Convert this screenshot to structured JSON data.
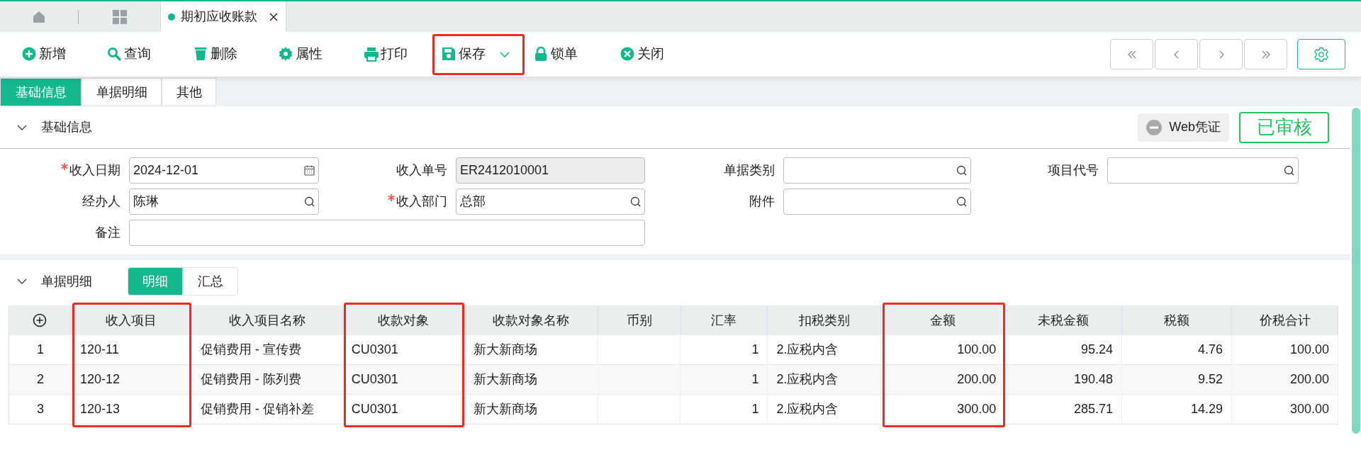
{
  "page_tabs": [
    {
      "title": "期初应收账款",
      "selected": true
    }
  ],
  "toolbar": [
    {
      "label": "新增",
      "dropdown": false,
      "highlighted": false
    },
    {
      "label": "查询",
      "dropdown": false,
      "highlighted": false
    },
    {
      "label": "删除",
      "dropdown": false,
      "highlighted": false
    },
    {
      "label": "属性",
      "dropdown": false,
      "highlighted": false
    },
    {
      "label": "打印",
      "dropdown": false,
      "highlighted": false
    },
    {
      "label": "保存",
      "dropdown": true,
      "highlighted": true
    },
    {
      "label": "锁单",
      "dropdown": false,
      "highlighted": false
    },
    {
      "label": "关闭",
      "dropdown": false,
      "highlighted": false
    }
  ],
  "view_tabs": [
    {
      "label": "基础信息",
      "selected": true
    },
    {
      "label": "单据明细",
      "selected": false
    },
    {
      "label": "其他",
      "selected": false
    }
  ],
  "basic_section": {
    "title": "基础信息",
    "expanded": true,
    "voucher_button": "Web凭证",
    "status_stamp": "已审核",
    "fields": [
      {
        "label": "收入日期",
        "value": "2024-12-01",
        "required": true,
        "kind": "date"
      },
      {
        "label": "收入单号",
        "value": "ER2412010001",
        "required": false,
        "kind": "readonly"
      },
      {
        "label": "单据类别",
        "required": false,
        "kind": "lookup"
      },
      {
        "label": "项目代号",
        "required": false,
        "kind": "lookup"
      },
      {
        "label": "经办人",
        "value": "陈琳",
        "required": false,
        "kind": "lookup"
      },
      {
        "label": "收入部门",
        "value": "总部",
        "required": true,
        "kind": "lookup"
      },
      {
        "label": "附件",
        "required": false,
        "kind": "lookup"
      },
      {
        "label": "备注",
        "required": false,
        "kind": "wide"
      }
    ]
  },
  "detail_section": {
    "title": "单据明细",
    "expanded": true,
    "modes": [
      {
        "label": "明细",
        "selected": true
      },
      {
        "label": "汇总",
        "selected": false
      }
    ]
  },
  "table": {
    "columns": [
      {
        "label": "收入项目",
        "kind": "text",
        "highlighted": true
      },
      {
        "label": "收入项目名称",
        "kind": "text",
        "highlighted": false
      },
      {
        "label": "收款对象",
        "kind": "text",
        "highlighted": true
      },
      {
        "label": "收款对象名称",
        "kind": "text",
        "highlighted": false
      },
      {
        "label": "币别",
        "kind": "text",
        "highlighted": false
      },
      {
        "label": "汇率",
        "kind": "number",
        "highlighted": false
      },
      {
        "label": "扣税类别",
        "kind": "text",
        "highlighted": false
      },
      {
        "label": "金额",
        "kind": "number",
        "highlighted": true
      },
      {
        "label": "未税金额",
        "kind": "number",
        "highlighted": false
      },
      {
        "label": "税额",
        "kind": "number",
        "highlighted": false
      },
      {
        "label": "价税合计",
        "kind": "number",
        "highlighted": false
      }
    ],
    "rows": [
      {
        "index": "1",
        "cells": [
          "120-11",
          "促销费用 - 宣传费",
          "CU0301",
          "新大新商场",
          "",
          "1",
          "2.应税内含",
          "100.00",
          "95.24",
          "4.76",
          "100.00"
        ]
      },
      {
        "index": "2",
        "cells": [
          "120-12",
          "促销费用 - 陈列费",
          "CU0301",
          "新大新商场",
          "",
          "1",
          "2.应税内含",
          "200.00",
          "190.48",
          "9.52",
          "200.00"
        ]
      },
      {
        "index": "3",
        "cells": [
          "120-13",
          "促销费用 - 促销补差",
          "CU0301",
          "新大新商场",
          "",
          "1",
          "2.应税内含",
          "300.00",
          "285.71",
          "14.29",
          "300.00"
        ]
      }
    ]
  }
}
